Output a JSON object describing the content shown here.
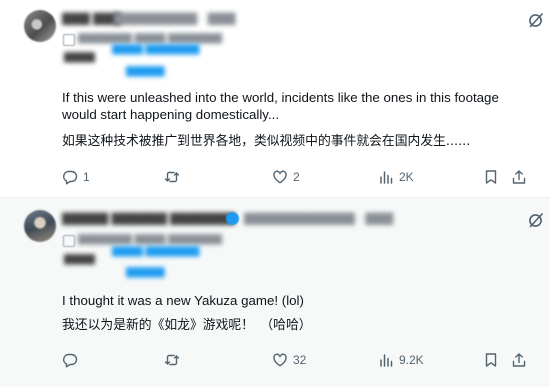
{
  "posts": [
    {
      "body_en": "If this were unleashed into the world, incidents like the ones in this footage would start happening domestically...",
      "body_cn": "如果这种技术被推广到世界各地，类似视频中的事件就会在国内发生......",
      "actions": {
        "replies": "1",
        "reposts": "",
        "likes": "2",
        "views": "2K"
      }
    },
    {
      "body_en": "I thought it was a new Yakuza game! (lol)",
      "body_cn": "我还以为是新的《如龙》游戏呢！　（哈哈）",
      "actions": {
        "replies": "",
        "reposts": "",
        "likes": "32",
        "views": "9.2K"
      }
    }
  ],
  "colors": {
    "text_primary": "#0f1419",
    "text_secondary": "#536471",
    "link_blue": "#1d9bf0",
    "verified_blue": "#1d9bf0",
    "divider": "#eff3f4"
  },
  "icons": [
    "grok-icon",
    "more-icon",
    "reply-icon",
    "repost-icon",
    "like-icon",
    "views-icon",
    "bookmark-icon",
    "share-icon",
    "translate-icon",
    "verified-badge-icon"
  ]
}
